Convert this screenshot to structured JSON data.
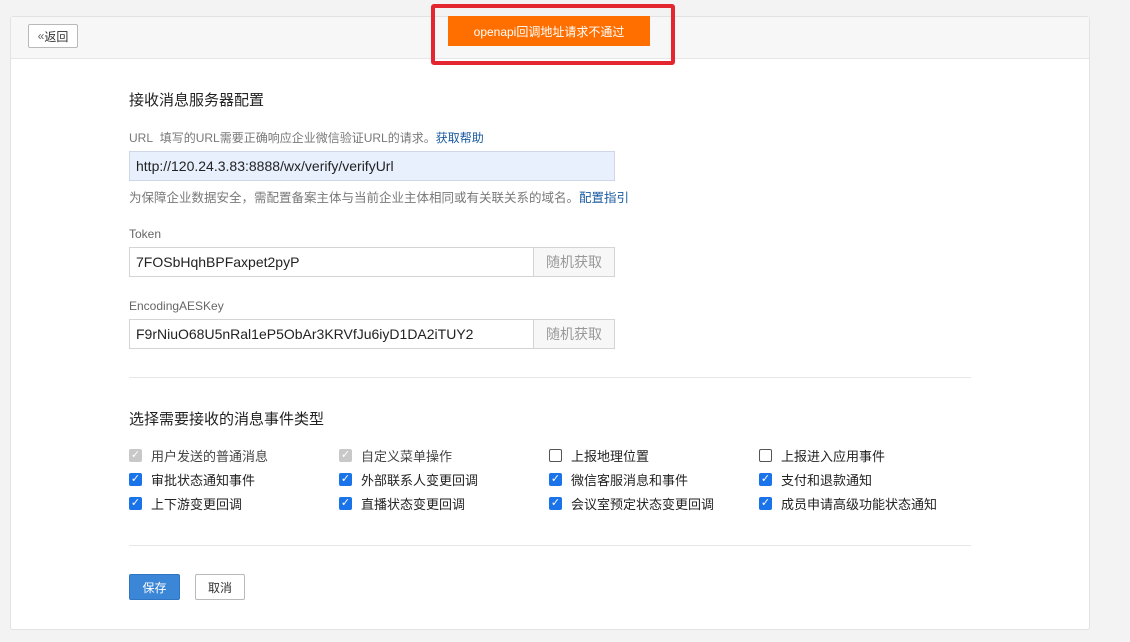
{
  "header": {
    "back_chevron": "«",
    "back_label": "返回"
  },
  "toast": {
    "message": "openapi回调地址请求不通过",
    "color": "#ff6f00",
    "highlight_color": "#e3262f"
  },
  "server_config": {
    "title": "接收消息服务器配置",
    "url": {
      "label": "URL",
      "description": "填写的URL需要正确响应企业微信验证URL的请求。",
      "help_link": "获取帮助",
      "value": "http://120.24.3.83:8888/wx/verify/verifyUrl",
      "security_note": "为保障企业数据安全，需配置备案主体与当前企业主体相同或有关联关系的域名。",
      "guide_link": "配置指引"
    },
    "token": {
      "label": "Token",
      "value": "7FOSbHqhBPFaxpet2pyP",
      "random_button": "随机获取"
    },
    "aes_key": {
      "label": "EncodingAESKey",
      "value": "F9rNiuO68U5nRal1eP5ObAr3KRVfJu6iyD1DA2iTUY2",
      "random_button": "随机获取"
    }
  },
  "events": {
    "title": "选择需要接收的消息事件类型",
    "items": [
      {
        "label": "用户发送的普通消息",
        "state": "disabled-checked"
      },
      {
        "label": "自定义菜单操作",
        "state": "disabled-checked"
      },
      {
        "label": "上报地理位置",
        "state": "unchecked"
      },
      {
        "label": "上报进入应用事件",
        "state": "unchecked"
      },
      {
        "label": "审批状态通知事件",
        "state": "checked"
      },
      {
        "label": "外部联系人变更回调",
        "state": "checked"
      },
      {
        "label": "微信客服消息和事件",
        "state": "checked"
      },
      {
        "label": "支付和退款通知",
        "state": "checked"
      },
      {
        "label": "上下游变更回调",
        "state": "checked"
      },
      {
        "label": "直播状态变更回调",
        "state": "checked"
      },
      {
        "label": "会议室预定状态变更回调",
        "state": "checked"
      },
      {
        "label": "成员申请高级功能状态通知",
        "state": "checked"
      }
    ]
  },
  "actions": {
    "save": "保存",
    "cancel": "取消"
  },
  "colors": {
    "primary": "#3b86d6",
    "link": "#1a5ba0",
    "checkbox": "#1a73e8"
  }
}
